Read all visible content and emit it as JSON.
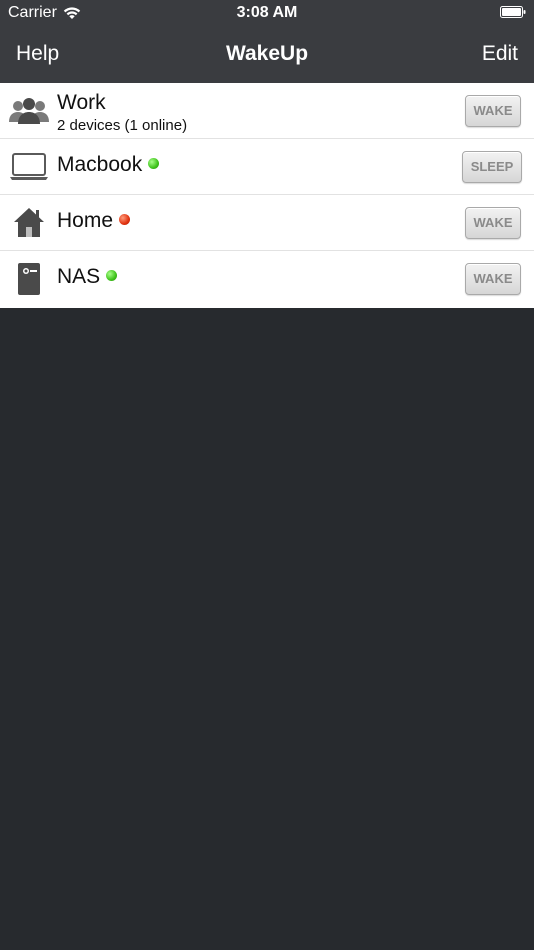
{
  "status_bar": {
    "carrier": "Carrier",
    "time": "3:08 AM"
  },
  "nav": {
    "left": "Help",
    "title": "WakeUp",
    "right": "Edit"
  },
  "colors": {
    "online": "#3ec21a",
    "offline": "#e0320f",
    "background": "#272a2e",
    "nav": "#3a3c40"
  },
  "devices": [
    {
      "name": "Work",
      "subtitle": "2 devices (1 online)",
      "icon": "group-icon",
      "status": "",
      "action": "WAKE"
    },
    {
      "name": "Macbook",
      "icon": "laptop-icon",
      "status": "online",
      "action": "SLEEP"
    },
    {
      "name": "Home",
      "icon": "house-icon",
      "status": "offline",
      "action": "WAKE"
    },
    {
      "name": "NAS",
      "icon": "nas-icon",
      "status": "online",
      "action": "WAKE"
    }
  ]
}
